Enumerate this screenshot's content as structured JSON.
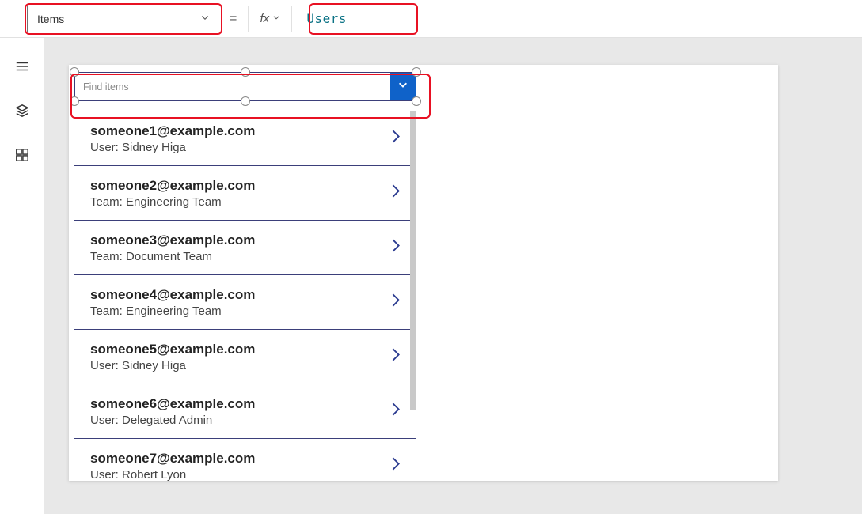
{
  "formulaBar": {
    "property": "Items",
    "equals": "=",
    "fxLabel": "fx",
    "formula": "Users"
  },
  "combobox": {
    "placeholder": "Find items"
  },
  "list": {
    "rows": [
      {
        "primary": "someone1@example.com",
        "secondary": "User: Sidney Higa"
      },
      {
        "primary": "someone2@example.com",
        "secondary": "Team: Engineering Team"
      },
      {
        "primary": "someone3@example.com",
        "secondary": "Team: Document Team"
      },
      {
        "primary": "someone4@example.com",
        "secondary": "Team: Engineering Team"
      },
      {
        "primary": "someone5@example.com",
        "secondary": "User: Sidney Higa"
      },
      {
        "primary": "someone6@example.com",
        "secondary": "User: Delegated Admin"
      },
      {
        "primary": "someone7@example.com",
        "secondary": "User: Robert Lyon"
      }
    ]
  }
}
